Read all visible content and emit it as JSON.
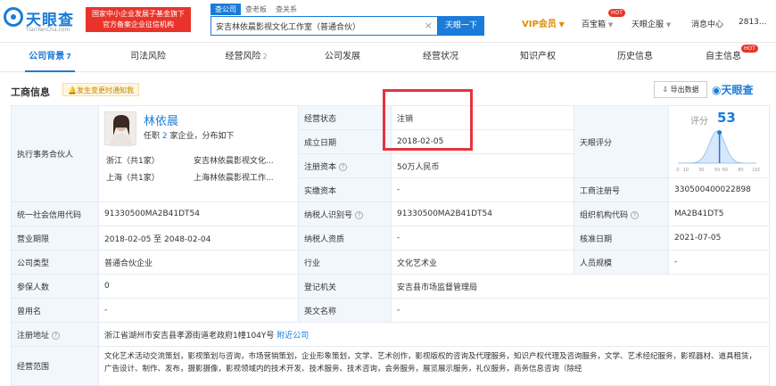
{
  "header": {
    "logo_text": "天眼查",
    "logo_sub": "TianYanCha.com",
    "banner_line1": "国家中小企业发展子基金旗下",
    "banner_line2": "官方备案企业征信机构",
    "search_tabs": [
      "查公司",
      "查老板",
      "查关系"
    ],
    "search_value": "安吉林依晨影视文化工作室（普通合伙）",
    "search_button": "天眼一下",
    "vip": "VIP会员",
    "baibaoxiang": "百宝箱",
    "qiye": "天眼企服",
    "messages": "消息中心",
    "user": "2813...",
    "hot": "HOT"
  },
  "tabs": [
    {
      "label": "公司背景",
      "count": "7"
    },
    {
      "label": "司法风险",
      "count": ""
    },
    {
      "label": "经营风险",
      "count": "2"
    },
    {
      "label": "公司发展",
      "count": ""
    },
    {
      "label": "经营状况",
      "count": ""
    },
    {
      "label": "知识产权",
      "count": ""
    },
    {
      "label": "历史信息",
      "count": ""
    },
    {
      "label": "自主信息",
      "count": ""
    }
  ],
  "section": {
    "title": "工商信息",
    "notify": "发生变更时通知我",
    "export": "导出数据",
    "watermark": "天眼查"
  },
  "partner": {
    "label": "执行事务合伙人",
    "name": "林依晨",
    "role_prefix": "任职",
    "role_count": "2",
    "role_suffix": "家企业，分布如下",
    "regions": [
      {
        "region": "浙江（共1家）",
        "company": "安吉林依晨影视文化..."
      },
      {
        "region": "上海（共1家）",
        "company": "上海林依晨影视工作..."
      }
    ]
  },
  "fields": {
    "status_label": "经营状态",
    "status_value": "注销",
    "date_label": "成立日期",
    "date_value": "2018-02-05",
    "capital_label": "注册资本",
    "capital_value": "50万人民币",
    "paid_label": "实缴资本",
    "paid_value": "-",
    "score_label": "天眼评分",
    "score_title": "评分",
    "score_value": "53",
    "regno_label": "工商注册号",
    "regno_value": "330500400022898",
    "uscc_label": "统一社会信用代码",
    "uscc_value": "91330500MA2B41DT54",
    "taxid_label": "纳税人识别号",
    "taxid_value": "91330500MA2B41DT54",
    "orgcode_label": "组织机构代码",
    "orgcode_value": "MA2B41DT5",
    "term_label": "营业期限",
    "term_value": "2018-02-05 至 2048-02-04",
    "taxq_label": "纳税人资质",
    "taxq_value": "-",
    "approve_label": "核准日期",
    "approve_value": "2021-07-05",
    "type_label": "公司类型",
    "type_value": "普通合伙企业",
    "industry_label": "行业",
    "industry_value": "文化艺术业",
    "staff_label": "人员规模",
    "staff_value": "-",
    "insured_label": "参保人数",
    "insured_value": "0",
    "authority_label": "登记机关",
    "authority_value": "安吉县市场监督管理局",
    "formername_label": "曾用名",
    "formername_value": "-",
    "engname_label": "英文名称",
    "engname_value": "-",
    "address_label": "注册地址",
    "address_value": "浙江省湖州市安吉县孝源街道老政府1幢104Y号",
    "nearby": "附近公司",
    "scope_label": "经营范围",
    "scope_value": "文化艺术活动交流策划，影视策划与咨询，市场营销策划，企业形象策划，文学、艺术创作，影视版权的咨询及代理服务，知识产权代理及咨询服务，文学、艺术经纪服务，影视器材、道具租赁，广告设计、制作、发布，摄影摄像，影视领域内的技术开发、技术服务、技术咨询，会务服务，展览展示服务，礼仪服务，商务信息咨询（除经"
  },
  "chart_data": {
    "type": "area",
    "title": "评分",
    "x_ticks": [
      "0",
      "10",
      "30",
      "50",
      "60",
      "80",
      "100"
    ],
    "marker_x": 53,
    "value": 53
  },
  "colors": {
    "accent": "#1a7cd8",
    "banner": "#e8342a",
    "highlight": "#e5323f",
    "label_bg": "#f2f7fd"
  }
}
